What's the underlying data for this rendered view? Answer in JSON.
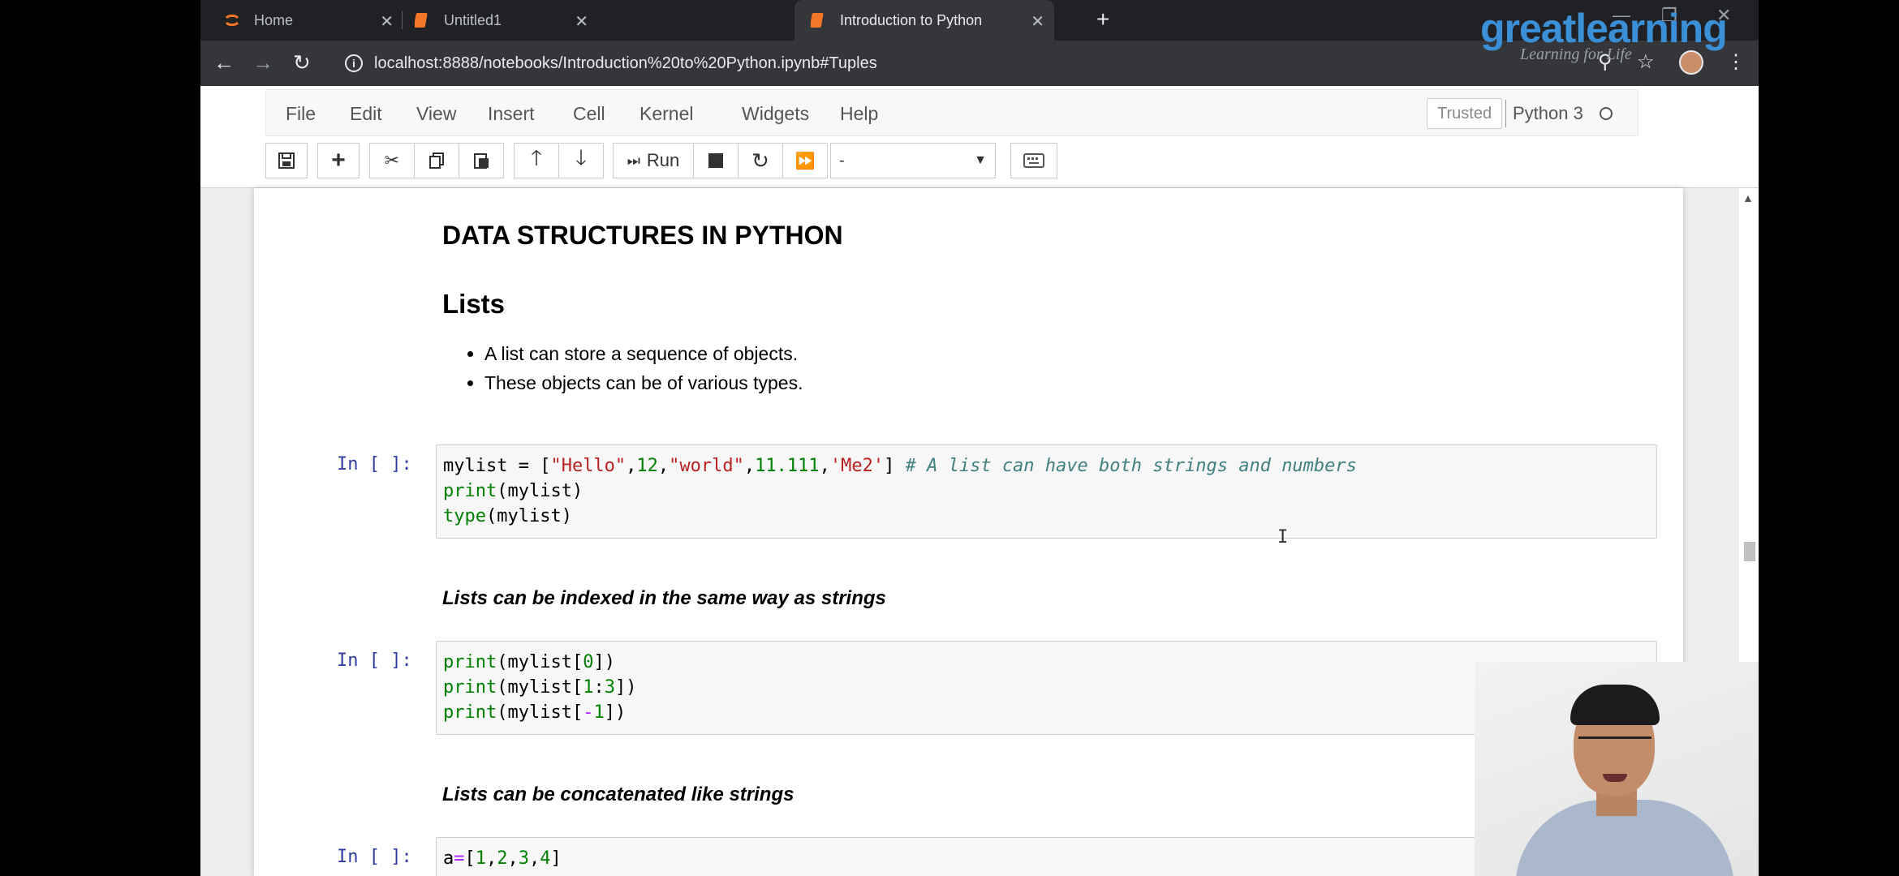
{
  "browser": {
    "tabs": [
      {
        "label": "Home",
        "icon": "jupyter-logo-icon"
      },
      {
        "label": "Untitled1",
        "icon": "notebook-icon"
      },
      {
        "label": "Introduction to Python",
        "icon": "notebook-icon",
        "active": true
      }
    ],
    "url": "localhost:8888/notebooks/Introduction%20to%20Python.ipynb#Tuples"
  },
  "watermark": {
    "brand_a": "great",
    "brand_b": "learning",
    "tagline": "Learning for Life"
  },
  "jupyter": {
    "menu": [
      "File",
      "Edit",
      "View",
      "Insert",
      "Cell",
      "Kernel",
      "Widgets",
      "Help"
    ],
    "trusted": "Trusted",
    "kernel": "Python 3",
    "run_label": "Run",
    "cell_type": "-"
  },
  "notebook": {
    "title": "DATA STRUCTURES IN PYTHON",
    "lists_heading": "Lists",
    "bullets": [
      "A list can store a sequence of objects.",
      "These objects can be of various types."
    ],
    "prompt": "In [ ]:",
    "cell1": {
      "line1_a": "mylist = [",
      "line1_s1": "\"Hello\"",
      "line1_c1": ",",
      "line1_n1": "12",
      "line1_c2": ",",
      "line1_s2": "\"world\"",
      "line1_c3": ",",
      "line1_n2": "11.111",
      "line1_c4": ",",
      "line1_s3": "'Me2'",
      "line1_b": "] ",
      "line1_comment": "# A list can have both strings and numbers",
      "line2_fn": "print",
      "line2_rest": "(mylist)",
      "line3_fn": "type",
      "line3_rest": "(mylist)"
    },
    "md_indexed": "Lists can be indexed in the same way as strings",
    "cell2": {
      "l1_fn": "print",
      "l1_a": "(mylist[",
      "l1_n": "0",
      "l1_b": "])",
      "l2_fn": "print",
      "l2_a": "(mylist[",
      "l2_n1": "1",
      "l2_c": ":",
      "l2_n2": "3",
      "l2_b": "])",
      "l3_fn": "print",
      "l3_a": "(mylist[",
      "l3_op": "-",
      "l3_n": "1",
      "l3_b": "])"
    },
    "md_concat": "Lists can be concatenated like strings",
    "cell3": {
      "a": "a",
      "op": "=",
      "open": "[",
      "n1": "1",
      "c1": ",",
      "n2": "2",
      "c2": ",",
      "n3": "3",
      "c3": ",",
      "n4": "4",
      "close": "]"
    }
  },
  "colors": {
    "brand_blue": "#3b8fd6",
    "prompt_blue": "#303f9f",
    "builtin_green": "#008000",
    "string_red": "#ba2121",
    "comment_teal": "#408080"
  }
}
